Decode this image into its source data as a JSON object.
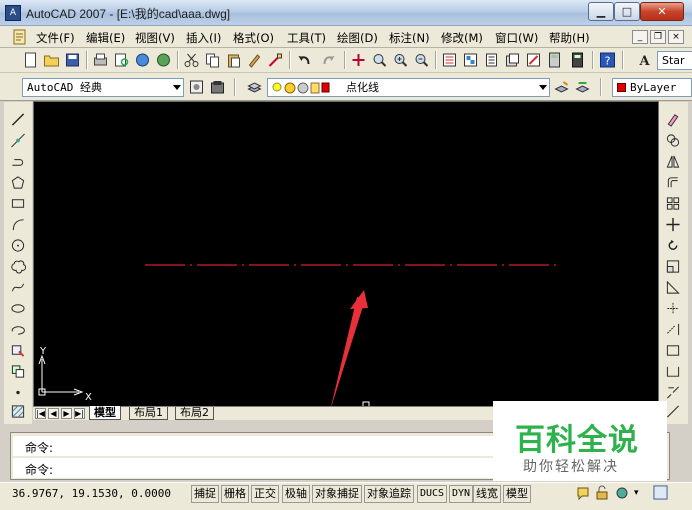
{
  "window": {
    "title": "AutoCAD 2007 - [E:\\我的cad\\aaa.dwg]",
    "controls": {
      "minimize": "▁",
      "maximize": "□",
      "close": "✕"
    }
  },
  "menu": {
    "items": [
      "文件(F)",
      "编辑(E)",
      "视图(V)",
      "插入(I)",
      "格式(O)",
      "工具(T)",
      "绘图(D)",
      "标注(N)",
      "修改(M)",
      "窗口(W)",
      "帮助(H)"
    ],
    "mdi": {
      "minimize": "_",
      "restore": "❐",
      "close": "×"
    }
  },
  "toolbar": {
    "workspace": "AutoCAD 经典",
    "layer": "点化线",
    "color": "ByLayer",
    "text_style": "Star"
  },
  "drawing": {
    "line_color": "#d0202a",
    "ucs_x": "X",
    "ucs_y": "Y",
    "arrow_color": "#e8303a"
  },
  "layout_tabs": [
    "模型",
    "布局1",
    "布局2"
  ],
  "command": {
    "line1": "命令:",
    "line2": "命令:"
  },
  "status": {
    "coords": "36.9767, 19.1530, 0.0000",
    "buttons": [
      "捕捉",
      "栅格",
      "正交",
      "极轴",
      "对象捕捉",
      "对象追踪",
      "DUCS",
      "DYN",
      "线宽",
      "模型"
    ]
  },
  "watermark": {
    "title": "百科全说",
    "subtitle": "助你轻松解决"
  }
}
